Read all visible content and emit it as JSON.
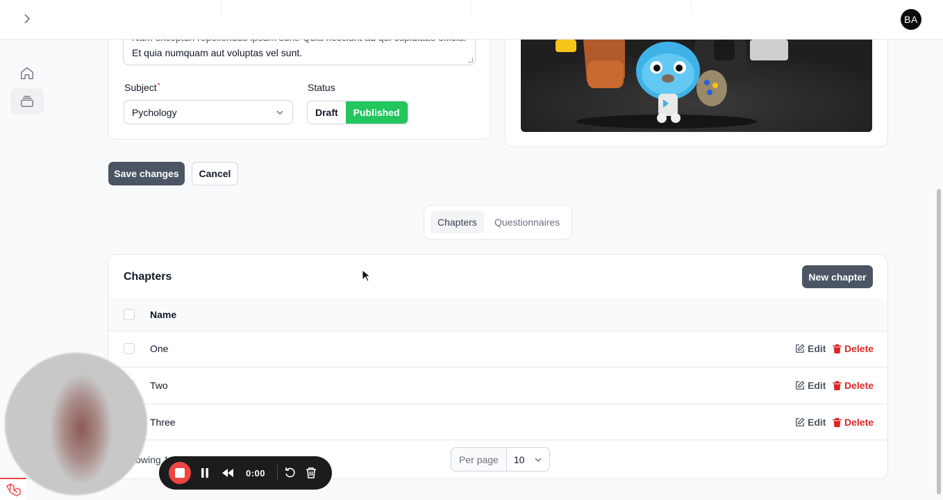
{
  "topbar": {
    "avatar_initials": "BA"
  },
  "form": {
    "description_line1": "Nam excepturi repellendus ipsum sunt. Quia nesciunt ad qui cupiditate officia.",
    "description_line2": "Et quia numquam aut voluptas vel sunt.",
    "subject_label": "Subject",
    "subject_required": "*",
    "subject_value": "Pychology",
    "status_label": "Status",
    "status_options": [
      "Draft",
      "Published"
    ],
    "status_selected": "Published"
  },
  "actions": {
    "save_label": "Save changes",
    "cancel_label": "Cancel"
  },
  "tabs": [
    {
      "label": "Chapters",
      "active": true
    },
    {
      "label": "Questionnaires",
      "active": false
    }
  ],
  "chapters": {
    "title": "Chapters",
    "new_button": "New chapter",
    "column_name": "Name",
    "rows": [
      {
        "name": "One",
        "edit": "Edit",
        "delete": "Delete"
      },
      {
        "name": "Two",
        "edit": "Edit",
        "delete": "Delete"
      },
      {
        "name": "Three",
        "edit": "Edit",
        "delete": "Delete"
      }
    ],
    "footer_text": "Showing 1 to 3 of 3 results",
    "per_page_label": "Per page",
    "per_page_value": "10"
  },
  "recorder": {
    "time": "0:00"
  },
  "colors": {
    "primary_button": "#4b5563",
    "published": "#22c55e",
    "danger": "#dc2626"
  }
}
